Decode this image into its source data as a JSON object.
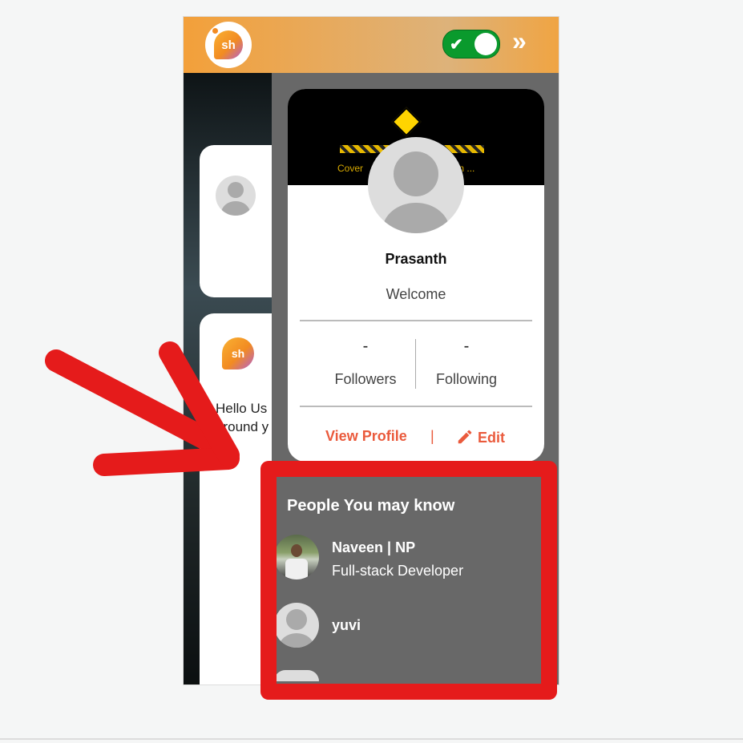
{
  "header": {
    "logo_text": "sh",
    "toggle_state": "on",
    "toggle_icon": "check-icon",
    "expand_icon": "double-chevron-right-icon",
    "expand_glyph": "»"
  },
  "feed": {
    "post_text": "Hello Us around y",
    "post_line1": "Hello Us",
    "post_line2": "around y"
  },
  "profile": {
    "cover_text": "Cover",
    "cover_text_right": "ion ...",
    "name": "Prasanth",
    "tagline": "Welcome",
    "followers_value": "-",
    "followers_label": "Followers",
    "following_value": "-",
    "following_label": "Following",
    "view_profile_label": "View Profile",
    "separator": "|",
    "edit_label": "Edit"
  },
  "people_you_may_know": {
    "title": "People You may know",
    "people": [
      {
        "name": "Naveen | NP",
        "subtitle": "Full-stack Developer"
      },
      {
        "name": "yuvi",
        "subtitle": ""
      }
    ]
  },
  "annotation": {
    "color": "#e51b1b"
  },
  "colors": {
    "accent_orange": "#ea5a3c",
    "header_gradient_start": "#f3a03a",
    "toggle_green": "#0a9a2d",
    "panel_gray": "#686868"
  }
}
